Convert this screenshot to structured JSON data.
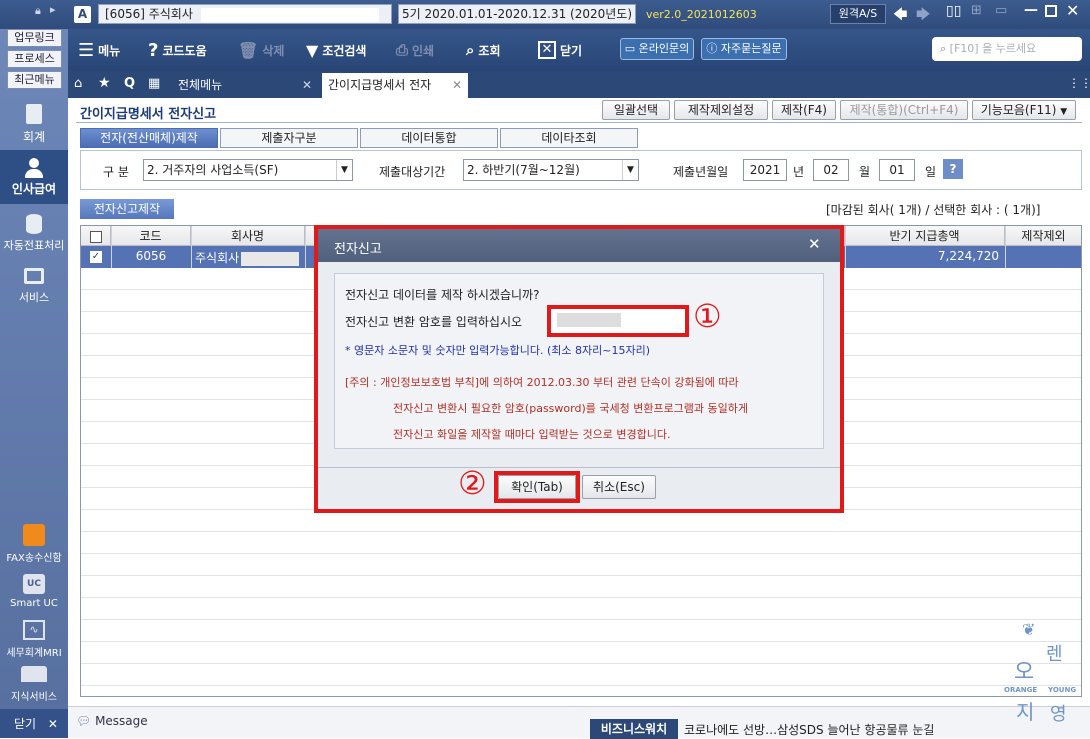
{
  "titlebar": {
    "company": "[6056] 주식회사",
    "period": "5기  2020.01.01-2020.12.31  (2020년도)",
    "version": "ver2.0_2021012603",
    "remote": "원격A/S"
  },
  "left": {
    "links": [
      "업무링크",
      "프로세스",
      "최근메뉴"
    ],
    "nav": [
      {
        "label": "회계",
        "icon": "calculator-icon"
      },
      {
        "label": "인사급여",
        "icon": "person-icon"
      },
      {
        "label": "자동전표처리",
        "icon": "database-icon"
      },
      {
        "label": "서비스",
        "icon": "monitor-icon"
      }
    ],
    "bottom": [
      {
        "label": "FAX송수신함",
        "icon": "fax-icon"
      },
      {
        "label": "Smart UC",
        "icon": "uc-icon"
      },
      {
        "label": "세무회계MRI",
        "icon": "pulse-icon"
      },
      {
        "label": "지식서비스",
        "icon": "book-icon"
      }
    ],
    "close": "닫기"
  },
  "toolbar": {
    "menu": "메뉴",
    "help": "코드도움",
    "delete": "삭제",
    "search": "조건검색",
    "print": "인쇄",
    "view": "조회",
    "close": "닫기",
    "inquiry": "온라인문의",
    "faq": "자주묻는질문",
    "search_placeholder": "[F10] 을 누르세요"
  },
  "tabs": {
    "all": "전체메뉴",
    "current": "간이지급명세서 전자"
  },
  "page": {
    "title": "간이지급명세서 전자신고",
    "buttons": [
      "일괄선택",
      "제작제외설정",
      "제작(F4)",
      "제작(통합)(Ctrl+F4)",
      "기능모음(F11)"
    ],
    "subtabs": [
      "전자(전산매체)제작",
      "제출자구분",
      "데이터통합",
      "데이타조회"
    ],
    "form": {
      "div_label": "구 분",
      "div_value": "2. 거주자의 사업소득(SF)",
      "period_label": "제출대상기간",
      "period_value": "2. 하반기(7월~12월)",
      "date_label": "제출년월일",
      "year": "2021",
      "year_unit": "년",
      "month": "02",
      "month_unit": "월",
      "day": "01",
      "day_unit": "일"
    },
    "section": "전자신고제작",
    "count": "[마감된 회사( 1개) / 선택한 회사 : ( 1개)]",
    "grid": {
      "headers": [
        "코드",
        "회사명",
        "반기 지급총액",
        "제작제외"
      ],
      "rows": [
        {
          "code": "6056",
          "name": "주식회사",
          "amount": "7,224,720"
        }
      ]
    }
  },
  "dialog": {
    "title": "전자신고",
    "line1": "전자신고 데이터를 제작 하시겠습니까?",
    "line2": "전자신고 변환 암호를 입력하십시오",
    "note": "* 영문자 소문자 및 숫자만 입력가능합니다. (최소 8자리~15자리)",
    "warn1": "[주의 : 개인정보보호법 부칙]에 의하여 2012.03.30 부터 관련 단속이 강화됨에 따라",
    "warn2": "전자신고 변환시 필요한 암호(password)를 국세청 변환프로그램과 동일하게",
    "warn3": "전자신고 화일을 제작할 때마다 입력받는 것으로 변경합니다.",
    "ok": "확인(Tab)",
    "cancel": "취소(Esc)",
    "mark1": "①",
    "mark2": "②"
  },
  "status": {
    "message": "Message",
    "news_label": "비즈니스워치",
    "news": "코로나에도 선방…삼성SDS 늘어난 항공물류 눈길"
  },
  "watermark": {
    "top": "오",
    "mid": "렌",
    "left": "ORANGE",
    "right": "YOUNG",
    "bottom1": "지",
    "bottom2": "영"
  }
}
